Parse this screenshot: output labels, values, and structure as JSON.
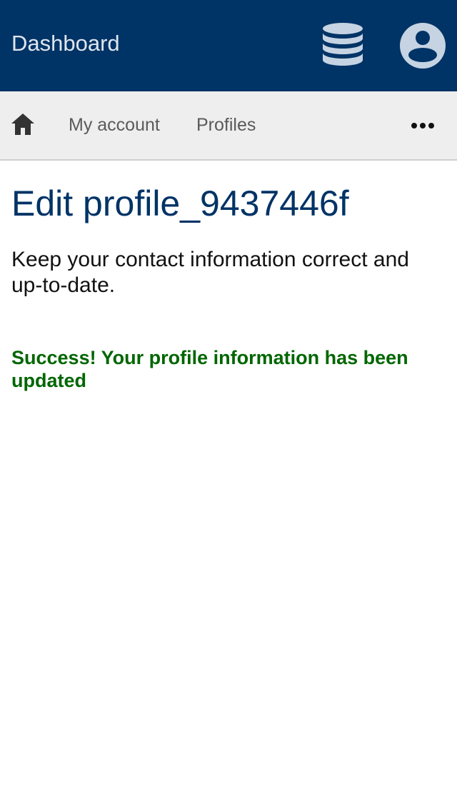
{
  "header": {
    "title": "Dashboard",
    "brand_color": "#003366",
    "icons": [
      "database-icon",
      "user-account-icon"
    ]
  },
  "nav": {
    "home_icon": "home-icon",
    "items": [
      {
        "label": "My account"
      },
      {
        "label": "Profiles"
      }
    ],
    "more_icon": "more-horizontal-icon"
  },
  "main": {
    "title": "Edit profile_9437446f",
    "intro": "Keep your contact information correct and up-to-date.",
    "success": "Success! Your profile information has been updated",
    "success_color": "#006600"
  }
}
